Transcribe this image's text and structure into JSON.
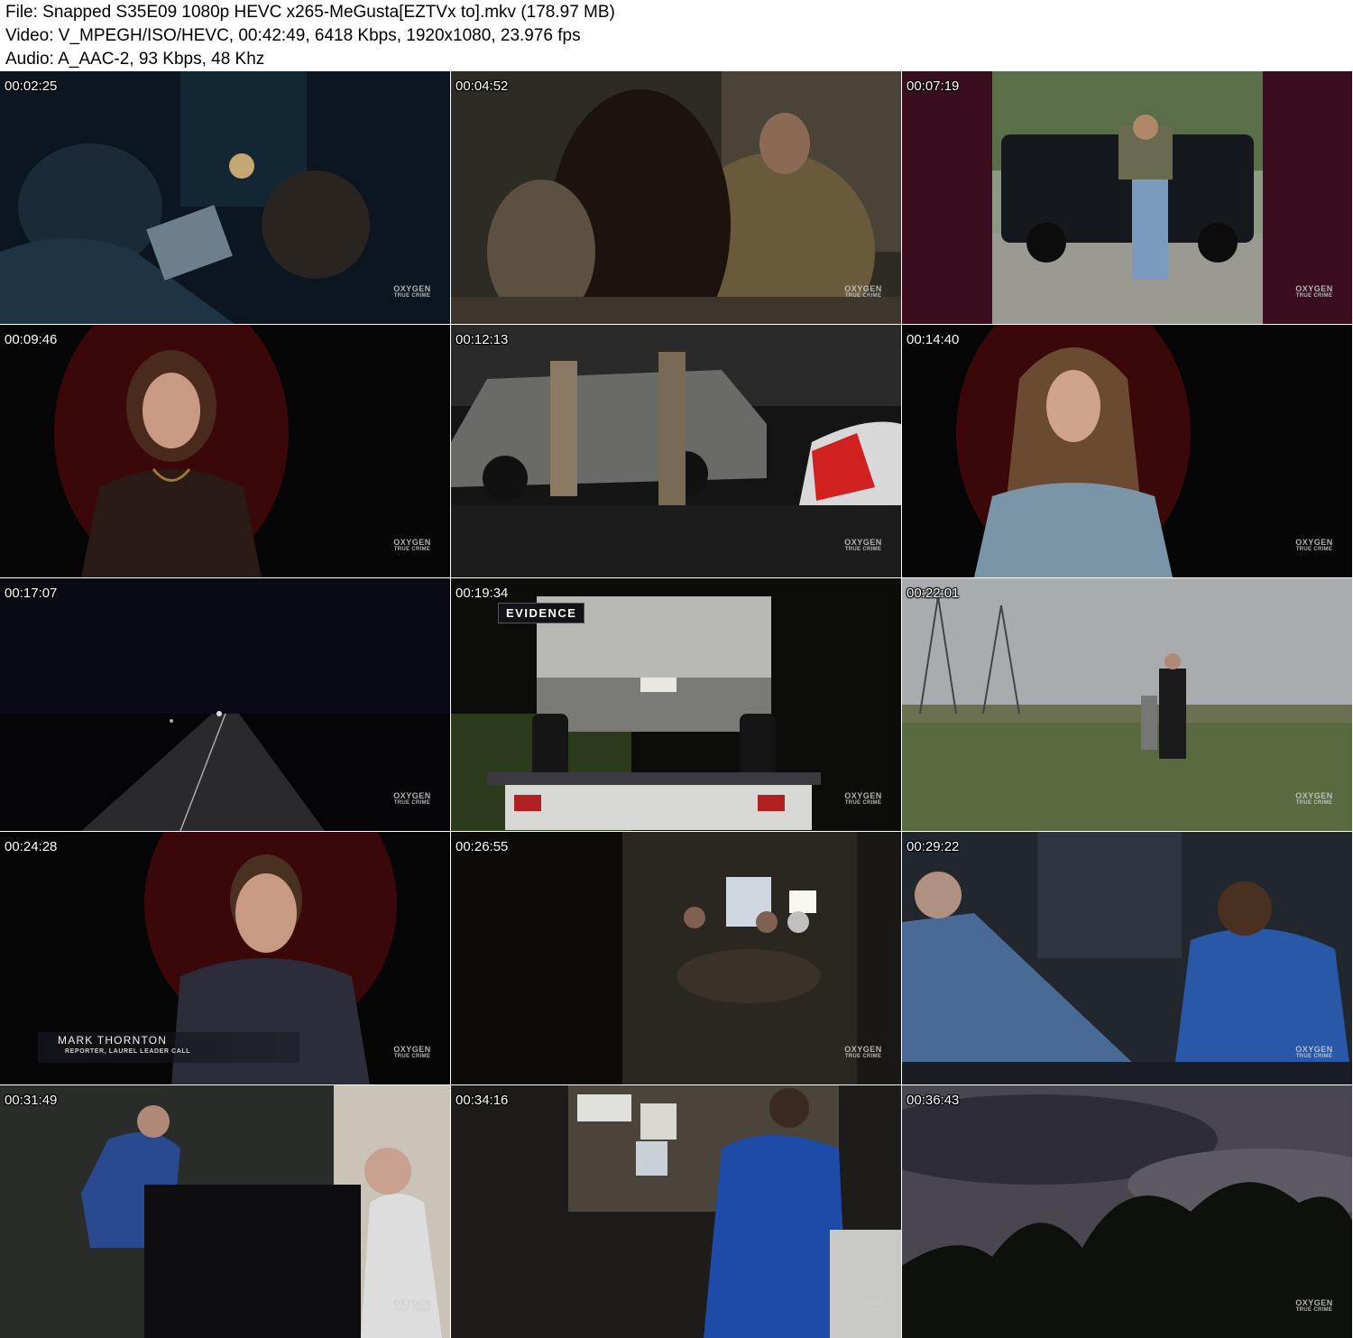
{
  "header": {
    "file_line": "File: Snapped S35E09 1080p HEVC x265-MeGusta[EZTVx to].mkv (178.97 MB)",
    "video_line": "Video: V_MPEGH/ISO/HEVC, 00:42:49, 6418 Kbps, 1920x1080, 23.976 fps",
    "audio_line": "Audio: A_AAC-2, 93 Kbps, 48 Khz"
  },
  "logo": {
    "top": "OXYGEN",
    "bottom": "TRUE CRIME"
  },
  "thumbnails": [
    {
      "time": "00:02:25"
    },
    {
      "time": "00:04:52"
    },
    {
      "time": "00:07:19"
    },
    {
      "time": "00:09:46"
    },
    {
      "time": "00:12:13"
    },
    {
      "time": "00:14:40"
    },
    {
      "time": "00:17:07"
    },
    {
      "time": "00:19:34",
      "badge": "EVIDENCE"
    },
    {
      "time": "00:22:01"
    },
    {
      "time": "00:24:28",
      "chyron_name": "MARK THORNTON",
      "chyron_title": "REPORTER, LAUREL LEADER CALL"
    },
    {
      "time": "00:26:55"
    },
    {
      "time": "00:29:22"
    },
    {
      "time": "00:31:49"
    },
    {
      "time": "00:34:16"
    },
    {
      "time": "00:36:43"
    }
  ]
}
